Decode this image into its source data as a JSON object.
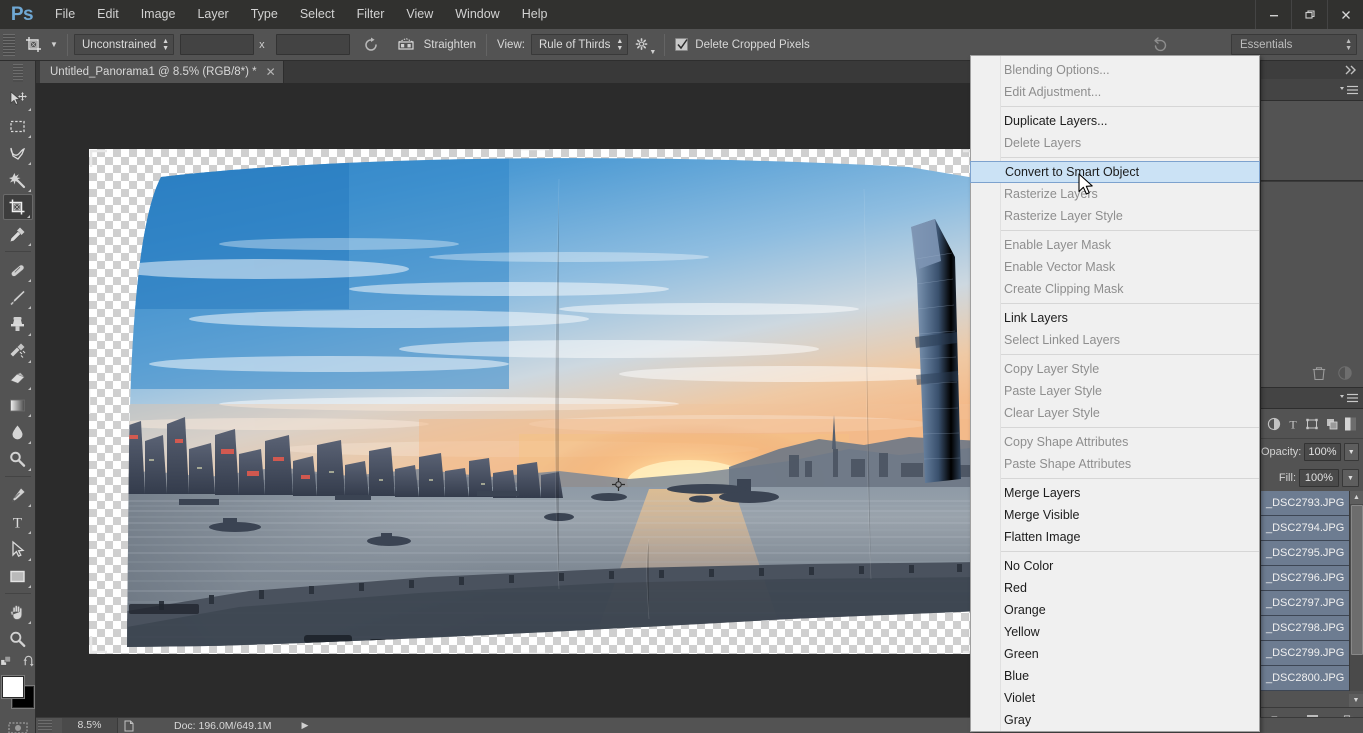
{
  "app": {
    "name": "Ps",
    "logo_color": "#6fa8d4"
  },
  "menubar": {
    "items": [
      {
        "label": "File"
      },
      {
        "label": "Edit"
      },
      {
        "label": "Image"
      },
      {
        "label": "Layer"
      },
      {
        "label": "Type"
      },
      {
        "label": "Select"
      },
      {
        "label": "Filter"
      },
      {
        "label": "View"
      },
      {
        "label": "Window"
      },
      {
        "label": "Help"
      }
    ],
    "window_controls": [
      {
        "name": "minimize",
        "glyph": "—"
      },
      {
        "name": "restore",
        "glyph": "❐"
      },
      {
        "name": "close",
        "glyph": "✕"
      }
    ]
  },
  "options_bar": {
    "tool_icon": "crop-tool-icon",
    "ratio_select": "Unconstrained",
    "width_value": "",
    "width_placeholder": "",
    "separator_x": "x",
    "height_value": "",
    "height_placeholder": "",
    "swap_icon": "swap-rotate-icon",
    "straighten_icon": "straighten-icon",
    "straighten_label": "Straighten",
    "view_label": "View:",
    "view_select": "Rule of Thirds",
    "gear_icon": "gear-icon",
    "delete_cropped_checked": true,
    "delete_cropped_label": "Delete Cropped Pixels",
    "reset_icon": "reset-icon",
    "workspace_select": "Essentials"
  },
  "document": {
    "tab_title": "Untitled_Panorama1 @ 8.5% (RGB/8*) *",
    "close_glyph": "✕"
  },
  "toolbar": {
    "tools": [
      {
        "name": "move-tool",
        "active": false
      },
      {
        "name": "rectangular-marquee-tool",
        "active": false
      },
      {
        "name": "lasso-tool",
        "active": false
      },
      {
        "name": "magic-wand-tool",
        "active": false
      },
      {
        "name": "crop-tool",
        "active": true
      },
      {
        "name": "eyedropper-tool",
        "active": false
      },
      {
        "name": "healing-brush-tool",
        "active": false
      },
      {
        "name": "brush-tool",
        "active": false
      },
      {
        "name": "clone-stamp-tool",
        "active": false
      },
      {
        "name": "history-brush-tool",
        "active": false
      },
      {
        "name": "eraser-tool",
        "active": false
      },
      {
        "name": "gradient-tool",
        "active": false
      },
      {
        "name": "blur-tool",
        "active": false
      },
      {
        "name": "dodge-tool",
        "active": false
      },
      {
        "name": "pen-tool",
        "active": false
      },
      {
        "name": "type-tool",
        "active": false
      },
      {
        "name": "path-selection-tool",
        "active": false
      },
      {
        "name": "rectangle-shape-tool",
        "active": false
      },
      {
        "name": "hand-tool",
        "active": false
      },
      {
        "name": "zoom-tool",
        "active": false
      }
    ],
    "foreground_color": "#ffffff",
    "background_color": "#000000"
  },
  "context_menu": {
    "items": [
      {
        "label": "Blending Options...",
        "state": "disabled",
        "sep_after": false
      },
      {
        "label": "Edit Adjustment...",
        "state": "disabled",
        "sep_after": true
      },
      {
        "label": "Duplicate Layers...",
        "state": "enabled",
        "sep_after": false
      },
      {
        "label": "Delete Layers",
        "state": "disabled",
        "sep_after": true
      },
      {
        "label": "Convert to Smart Object",
        "state": "selected",
        "sep_after": false
      },
      {
        "label": "Rasterize Layers",
        "state": "disabled",
        "sep_after": false
      },
      {
        "label": "Rasterize Layer Style",
        "state": "disabled",
        "sep_after": true
      },
      {
        "label": "Enable Layer Mask",
        "state": "disabled",
        "sep_after": false
      },
      {
        "label": "Enable Vector Mask",
        "state": "disabled",
        "sep_after": false
      },
      {
        "label": "Create Clipping Mask",
        "state": "disabled",
        "sep_after": true
      },
      {
        "label": "Link Layers",
        "state": "enabled",
        "sep_after": false
      },
      {
        "label": "Select Linked Layers",
        "state": "disabled",
        "sep_after": true
      },
      {
        "label": "Copy Layer Style",
        "state": "disabled",
        "sep_after": false
      },
      {
        "label": "Paste Layer Style",
        "state": "disabled",
        "sep_after": false
      },
      {
        "label": "Clear Layer Style",
        "state": "disabled",
        "sep_after": true
      },
      {
        "label": "Copy Shape Attributes",
        "state": "disabled",
        "sep_after": false
      },
      {
        "label": "Paste Shape Attributes",
        "state": "disabled",
        "sep_after": true
      },
      {
        "label": "Merge Layers",
        "state": "enabled",
        "sep_after": false
      },
      {
        "label": "Merge Visible",
        "state": "enabled",
        "sep_after": false
      },
      {
        "label": "Flatten Image",
        "state": "enabled",
        "sep_after": true
      },
      {
        "label": "No Color",
        "state": "enabled",
        "sep_after": false
      },
      {
        "label": "Red",
        "state": "enabled",
        "sep_after": false
      },
      {
        "label": "Orange",
        "state": "enabled",
        "sep_after": false
      },
      {
        "label": "Yellow",
        "state": "enabled",
        "sep_after": false
      },
      {
        "label": "Green",
        "state": "enabled",
        "sep_after": false
      },
      {
        "label": "Blue",
        "state": "enabled",
        "sep_after": false
      },
      {
        "label": "Violet",
        "state": "enabled",
        "sep_after": false
      },
      {
        "label": "Gray",
        "state": "enabled",
        "sep_after": false
      }
    ],
    "highlight_bg": "#cbe2f5",
    "highlight_border": "#7da2ce"
  },
  "layers_panel": {
    "opacity_label": "Opacity:",
    "opacity_value": "100%",
    "fill_label": "Fill:",
    "fill_value": "100%",
    "blend_icons": [
      "circle-halftone-icon",
      "type-T-icon",
      "transform-box-icon",
      "shape-layers-icon",
      "adjustment-halftone-icon"
    ],
    "layers": [
      {
        "name": "_DSC2793.JPG"
      },
      {
        "name": "_DSC2794.JPG"
      },
      {
        "name": "_DSC2795.JPG"
      },
      {
        "name": "_DSC2796.JPG"
      },
      {
        "name": "_DSC2797.JPG"
      },
      {
        "name": "_DSC2798.JPG"
      },
      {
        "name": "_DSC2799.JPG"
      },
      {
        "name": "_DSC2800.JPG"
      }
    ],
    "bottom_buttons": [
      "new-group-icon",
      "new-layer-icon",
      "delete-layer-icon"
    ]
  },
  "status_bar": {
    "zoom": "8.5%",
    "doc_icon": "document-icon",
    "doc_info": "Doc: 196.0M/649.1M",
    "expand_glyph": "▶"
  },
  "canvas": {
    "crosshair_icon": "crop-center-crosshair-icon",
    "transparency_checker": true,
    "image_description": "Hong Kong Victoria Harbour panorama at sunset"
  }
}
